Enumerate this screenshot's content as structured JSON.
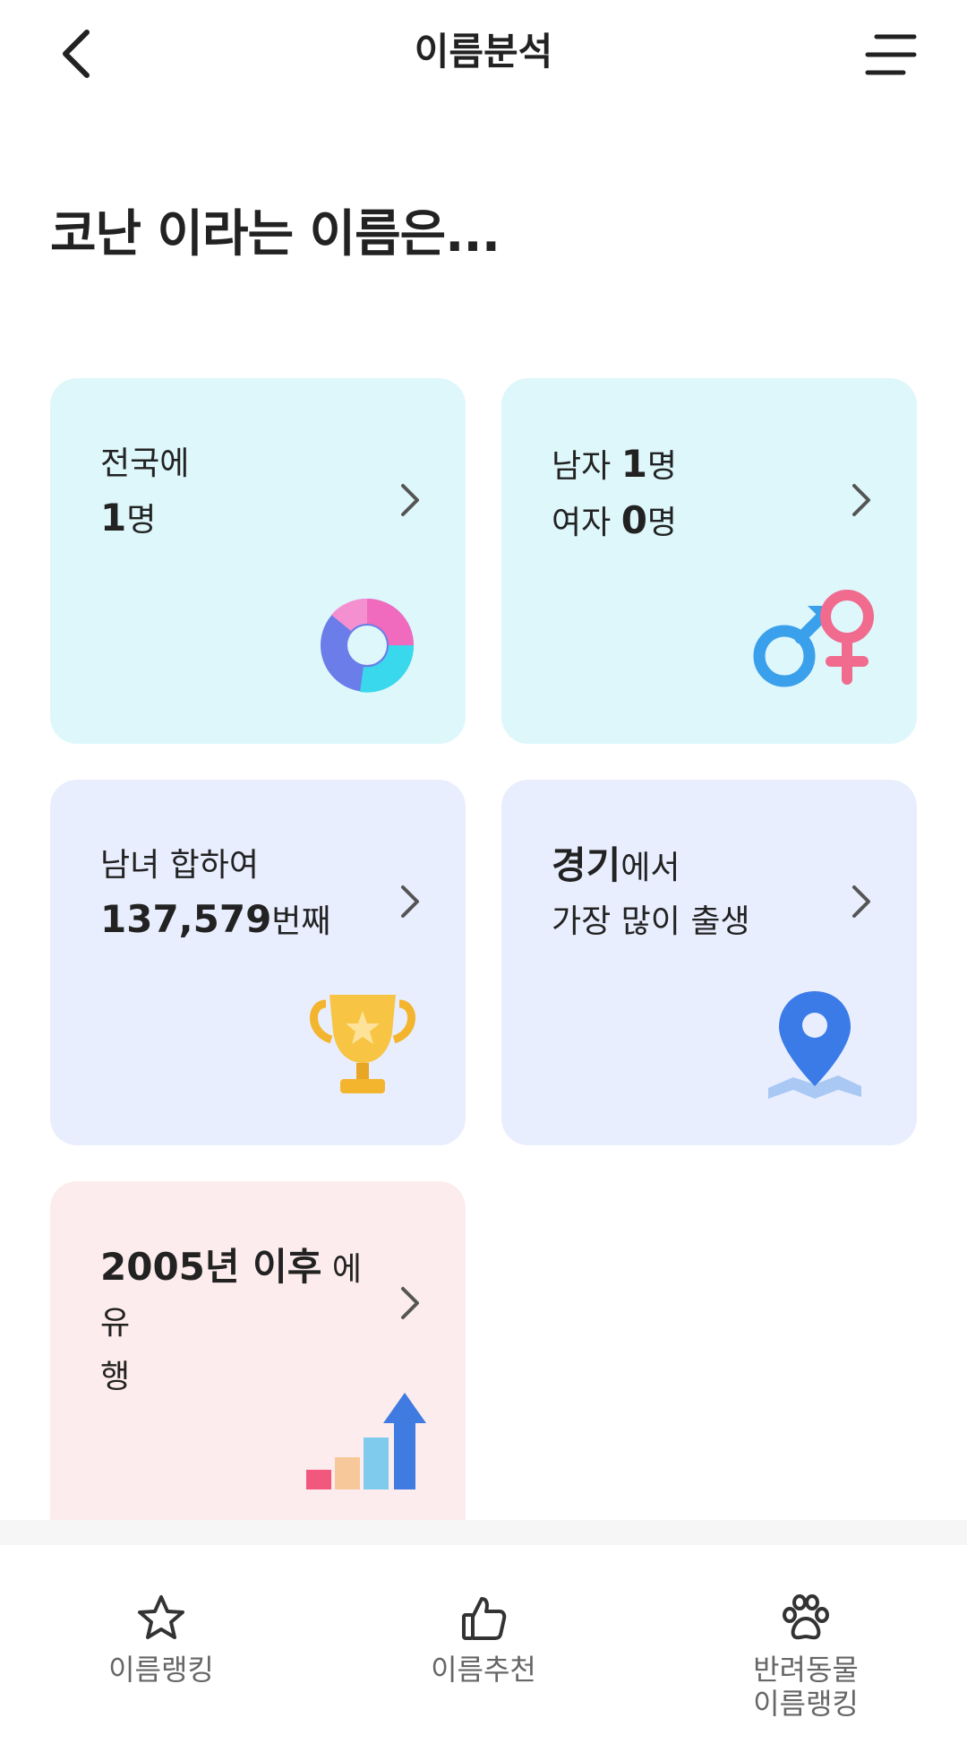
{
  "header": {
    "title": "이름분석"
  },
  "headline": "코난 이라는 이름은...",
  "cards": {
    "population": {
      "line1": "전국에",
      "count": "1",
      "unit": "명"
    },
    "gender": {
      "male_label": "남자 ",
      "male_count": "1",
      "male_unit": "명",
      "female_label": "여자 ",
      "female_count": "0",
      "female_unit": "명"
    },
    "rank": {
      "line1": "남녀 합하여",
      "rank": "137,579",
      "suffix": "번째"
    },
    "region": {
      "region": "경기",
      "suffix": "에서",
      "line2": "가장 많이 출생"
    },
    "trend": {
      "year_bold": "2005년 이후",
      "rest": " 에 유",
      "line2": "행"
    }
  },
  "nav": {
    "ranking": "이름랭킹",
    "recommend": "이름추천",
    "pet_line1": "반려동물",
    "pet_line2": "이름랭킹"
  },
  "colors": {
    "cyan_card": "#def7fb",
    "lavender_card": "#e9eefe",
    "pink_card": "#fdeced"
  },
  "icons": [
    "back-icon",
    "menu-icon",
    "chevron-right-icon",
    "pie-chart-icon",
    "gender-icon",
    "trophy-icon",
    "map-pin-icon",
    "bar-chart-arrow-icon",
    "star-icon",
    "thumbs-up-icon",
    "paw-icon"
  ]
}
